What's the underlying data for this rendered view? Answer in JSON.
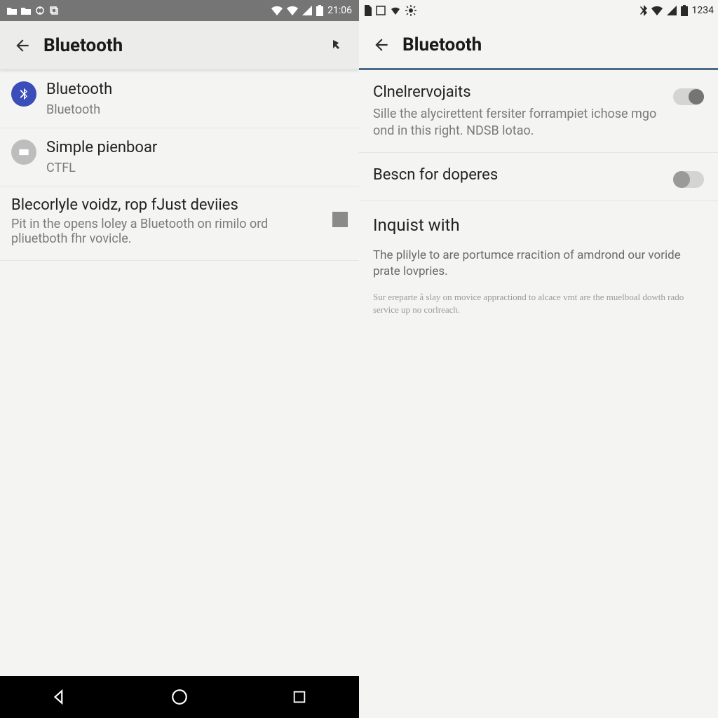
{
  "left": {
    "status": {
      "time": "21:06"
    },
    "header": {
      "title": "Bluetooth"
    },
    "items": [
      {
        "title": "Bluetooth",
        "sub": "Bluetooth"
      },
      {
        "title": "Simple pienboar",
        "sub": "CTFL"
      }
    ],
    "check": {
      "title": "Blecorlyle voidz, rop fJust deviies",
      "desc": "Pit in the opens loley a Bluetooth on rimilo ord pliuetboth fhr vovicle."
    }
  },
  "right": {
    "status": {
      "time": "1234"
    },
    "header": {
      "title": "Bluetooth"
    },
    "settings": [
      {
        "title": "Clnelrervojaits",
        "desc": "Sille the alycirettent fersiter forrampiet ichose mgo ond in this right.  NDSB lotao."
      },
      {
        "title": "Bescn for doperes",
        "desc": ""
      }
    ],
    "section": {
      "header": "Inquist with",
      "p1": "The plilyle to are portumce rracition of amdrond our voride prate lovpries.",
      "p2": "Sur ereparte å slay on movice appractiond to alcace vmt are the muelboal dowth rado service up no corlreach."
    }
  }
}
